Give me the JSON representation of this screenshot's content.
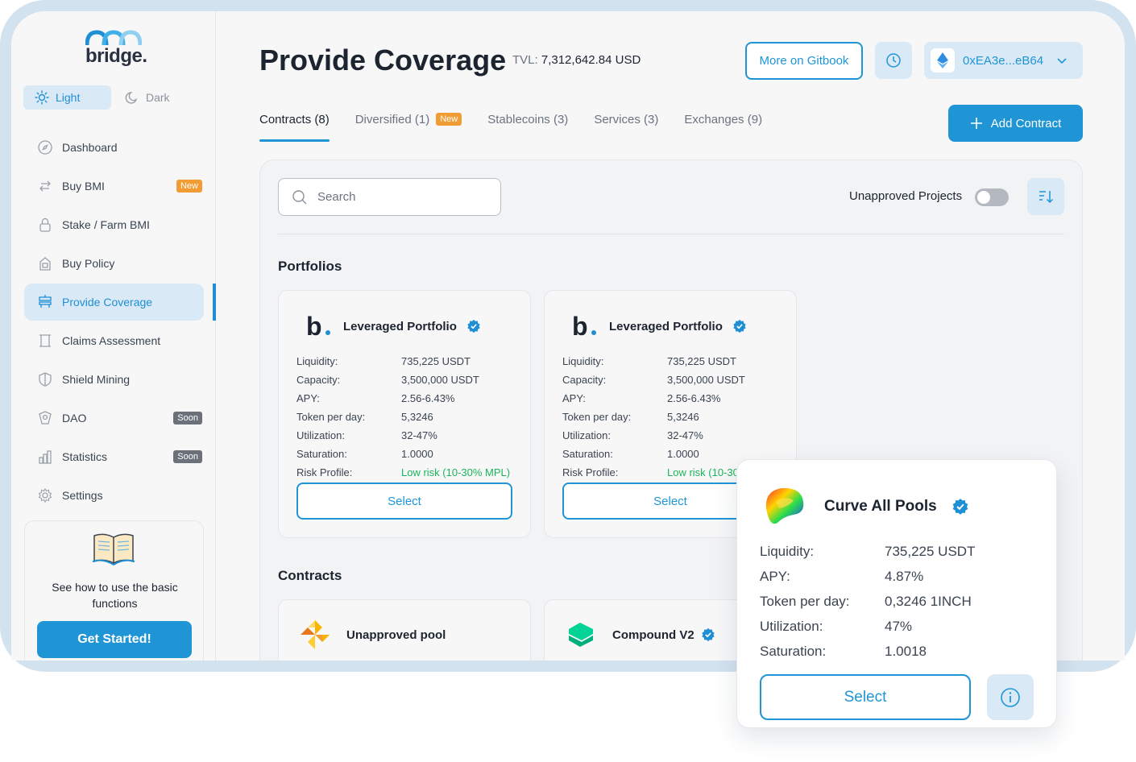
{
  "brand": {
    "name": "bridge."
  },
  "theme": {
    "light": "Light",
    "dark": "Dark"
  },
  "sidebar": {
    "items": [
      {
        "label": "Dashboard",
        "icon": "compass-icon"
      },
      {
        "label": "Buy BMI",
        "icon": "swap-icon",
        "badge": "New"
      },
      {
        "label": "Stake / Farm BMI",
        "icon": "lock-icon"
      },
      {
        "label": "Buy Policy",
        "icon": "policy-icon"
      },
      {
        "label": "Provide Coverage",
        "icon": "coverage-icon",
        "active": true
      },
      {
        "label": "Claims Assessment",
        "icon": "scroll-icon"
      },
      {
        "label": "Shield Mining",
        "icon": "shield-icon"
      },
      {
        "label": "DAO",
        "icon": "dao-icon",
        "badge": "Soon"
      },
      {
        "label": "Statistics",
        "icon": "chart-icon",
        "badge": "Soon"
      },
      {
        "label": "Settings",
        "icon": "gear-icon"
      }
    ],
    "help": {
      "text": "See how to use the basic functions",
      "button": "Get Started!"
    }
  },
  "header": {
    "title": "Provide Coverage",
    "tvl_label": "TVL:",
    "tvl_value": "7,312,642.84 USD",
    "gitbook_button": "More on Gitbook",
    "wallet": "0xEA3e...eB64"
  },
  "tabs": [
    {
      "label": "Contracts (8)",
      "active": true
    },
    {
      "label": "Diversified (1)",
      "badge": "New"
    },
    {
      "label": "Stablecoins (3)"
    },
    {
      "label": "Services (3)"
    },
    {
      "label": "Exchanges (9)"
    }
  ],
  "add_contract": "Add Contract",
  "search": {
    "placeholder": "Search"
  },
  "unapproved_label": "Unapproved Projects",
  "sections": {
    "portfolios": "Portfolios",
    "contracts": "Contracts"
  },
  "portfolio_card": {
    "name": "Leveraged Portfolio",
    "logo": "b",
    "rows": [
      {
        "k": "Liquidity:",
        "v": "735,225 USDT"
      },
      {
        "k": "Capacity:",
        "v": "3,500,000 USDT"
      },
      {
        "k": "APY:",
        "v": "2.56-6.43%"
      },
      {
        "k": "Token per day:",
        "v": "5,3246"
      },
      {
        "k": "Utilization:",
        "v": "32-47%"
      },
      {
        "k": "Saturation:",
        "v": "1.0000"
      },
      {
        "k": "Risk Profile:",
        "v": "Low risk (10-30% MPL)"
      }
    ],
    "select": "Select"
  },
  "contract_cards": [
    {
      "name": "Unapproved pool"
    },
    {
      "name": "Compound V2"
    }
  ],
  "popup": {
    "name": "Curve All Pools",
    "rows": [
      {
        "k": "Liquidity:",
        "v": "735,225 USDT"
      },
      {
        "k": "APY:",
        "v": "4.87%"
      },
      {
        "k": "Token per day:",
        "v": "0,3246 1INCH"
      },
      {
        "k": "Utilization:",
        "v": "47%"
      },
      {
        "k": "Saturation:",
        "v": "1.0018"
      }
    ],
    "select": "Select"
  },
  "colors": {
    "accent": "#1f95d6",
    "accent_light": "#d9e9f5",
    "new_badge": "#f29d33",
    "soon_badge": "#6b7079",
    "low_risk": "#1cb45a"
  }
}
